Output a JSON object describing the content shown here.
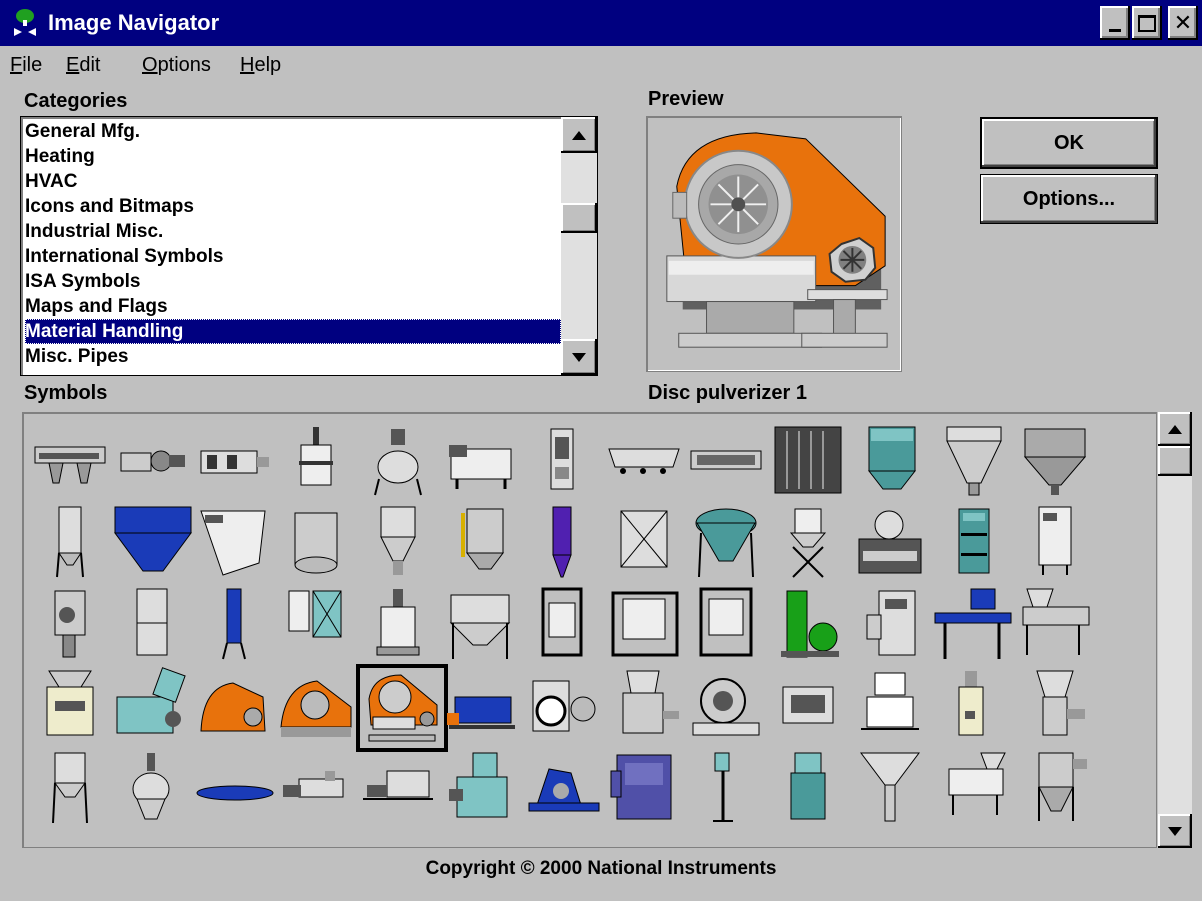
{
  "window": {
    "title": "Image Navigator"
  },
  "menu": [
    "File",
    "Edit",
    "Options",
    "Help"
  ],
  "categories": {
    "label": "Categories",
    "items": [
      "General Mfg.",
      "Heating",
      "HVAC",
      "Icons and Bitmaps",
      "Industrial Misc.",
      "International Symbols",
      "ISA Symbols",
      "Maps and Flags",
      "Material Handling",
      "Misc. Pipes"
    ],
    "selected": "Material Handling"
  },
  "preview": {
    "label": "Preview",
    "caption": "Disc pulverizer 1"
  },
  "buttons": {
    "ok": "OK",
    "options": "Options..."
  },
  "symbols": {
    "label": "Symbols",
    "selected": "Disc pulverizer 1"
  },
  "footer": {
    "copyright": "Copyright © 2000 National Instruments"
  },
  "colors": {
    "title_bar": "#000080",
    "selection": "#000080",
    "machine_orange": "#e8720c",
    "machine_blue": "#1a3bb8",
    "machine_teal": "#4a9a9a",
    "machine_green": "#18a018"
  }
}
